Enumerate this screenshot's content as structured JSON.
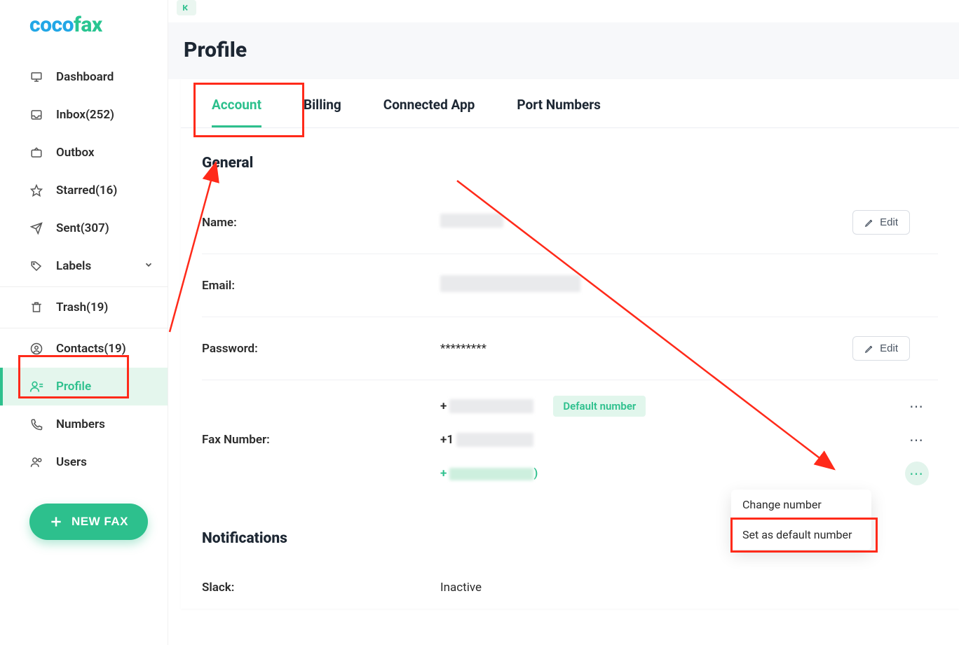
{
  "brand": {
    "part1": "coco",
    "part2": "fax"
  },
  "sidebar": {
    "items": [
      {
        "label": "Dashboard"
      },
      {
        "label": "Inbox(252)"
      },
      {
        "label": "Outbox"
      },
      {
        "label": "Starred(16)"
      },
      {
        "label": "Sent(307)"
      },
      {
        "label": "Labels"
      },
      {
        "label": "Trash(19)"
      },
      {
        "label": "Contacts(19)"
      },
      {
        "label": "Profile"
      },
      {
        "label": "Numbers"
      },
      {
        "label": "Users"
      }
    ],
    "new_fax": "NEW FAX"
  },
  "page": {
    "title": "Profile"
  },
  "tabs": [
    {
      "label": "Account"
    },
    {
      "label": "Billing"
    },
    {
      "label": "Connected App"
    },
    {
      "label": "Port Numbers"
    }
  ],
  "general": {
    "heading": "General",
    "name_label": "Name:",
    "email_label": "Email:",
    "password_label": "Password:",
    "password_value": "*********",
    "fax_label": "Fax Number:",
    "edit": "Edit",
    "default_badge": "Default number",
    "fax_numbers": [
      {
        "prefix": "+"
      },
      {
        "prefix": "+1"
      },
      {
        "prefix": "+"
      }
    ]
  },
  "dropdown": {
    "change": "Change number",
    "set_default": "Set as default number"
  },
  "notifications": {
    "heading": "Notifications",
    "slack_label": "Slack:",
    "slack_value": "Inactive"
  }
}
